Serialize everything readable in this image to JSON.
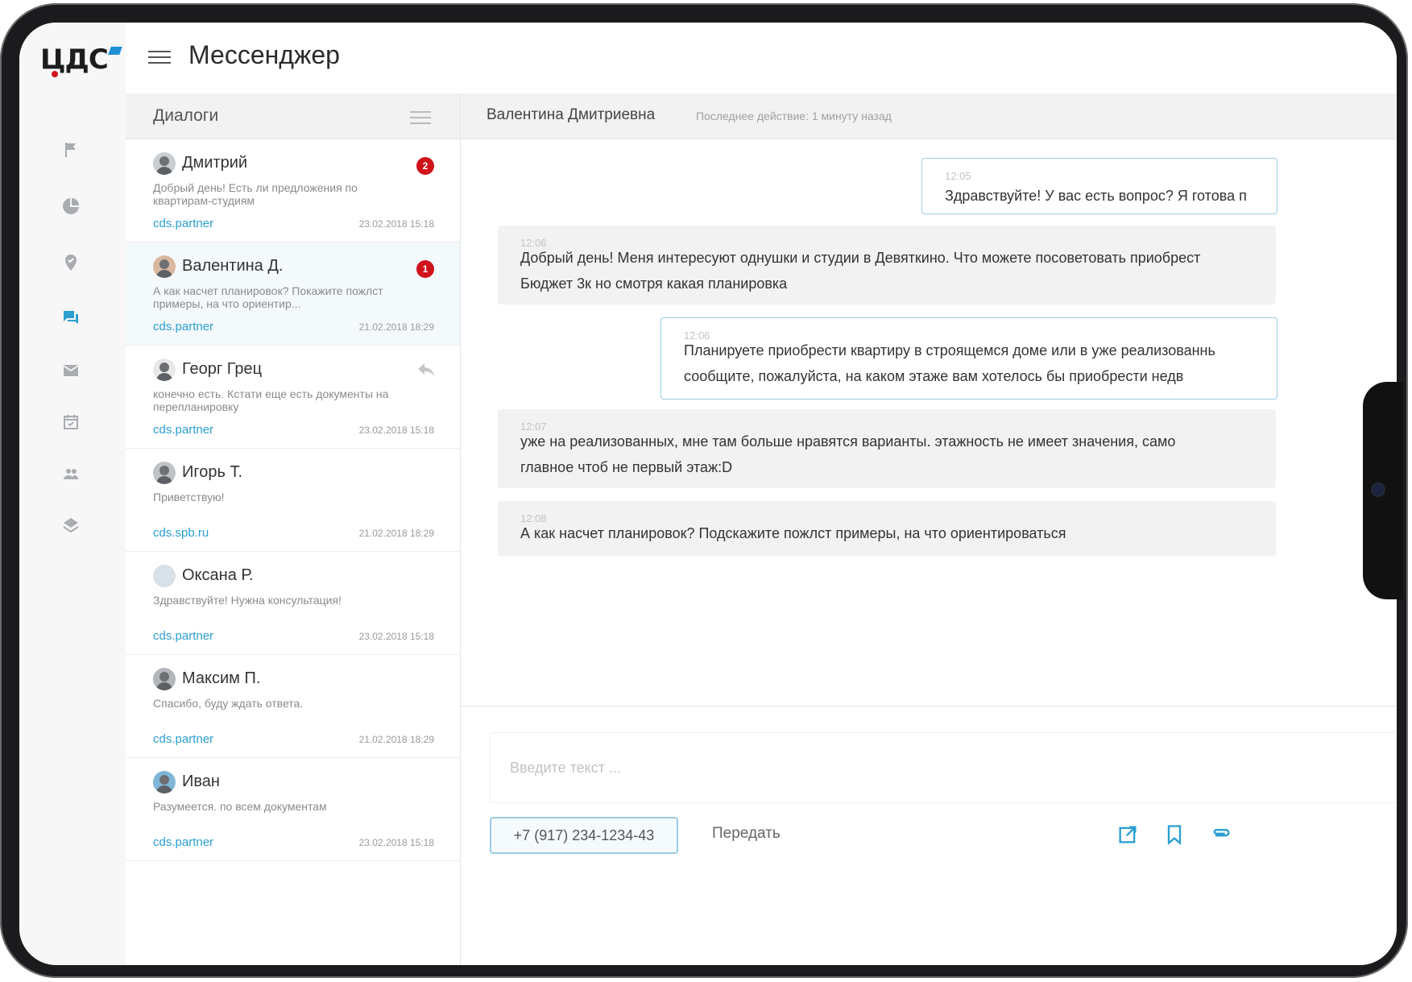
{
  "app": {
    "logo_text": "ЦДС",
    "page_title": "Мессенджер"
  },
  "rail": {
    "items": [
      {
        "icon": "flag-icon",
        "active": false
      },
      {
        "icon": "pie-chart-icon",
        "active": false
      },
      {
        "icon": "location-pin-icon",
        "active": false
      },
      {
        "icon": "chat-icon",
        "active": true
      },
      {
        "icon": "mail-icon",
        "active": false
      },
      {
        "icon": "calendar-icon",
        "active": false
      },
      {
        "icon": "people-icon",
        "active": false
      },
      {
        "icon": "layers-icon",
        "active": false
      }
    ]
  },
  "dialogs": {
    "title": "Диалоги",
    "items": [
      {
        "name": "Дмитрий",
        "snippet": "Добрый день! Есть ли предложения по квартирам-студиям",
        "source": "cds.partner",
        "date": "23.02.2018 15:18",
        "badge": "2"
      },
      {
        "name": "Валентина Д.",
        "snippet": "А как насчет планировок? Покажите пожлст примеры, на что ориентир...",
        "source": "cds.partner",
        "date": "21.02.2018 18:29",
        "badge": "1"
      },
      {
        "name": "Георг Грец",
        "snippet": "конечно есть.  Кстати еще есть документы на перепланировку",
        "source": "cds.partner",
        "date": "23.02.2018 15:18",
        "badge": ""
      },
      {
        "name": "Игорь Т.",
        "snippet": "Приветствую!",
        "source": "cds.spb.ru",
        "date": "21.02.2018 18:29",
        "badge": ""
      },
      {
        "name": "Оксана Р.",
        "snippet": "Здравствуйте! Нужна консультация!",
        "source": "cds.partner",
        "date": "23.02.2018 15:18",
        "badge": ""
      },
      {
        "name": "Максим П.",
        "snippet": "Спасибо, буду ждать ответа.",
        "source": "cds.partner",
        "date": "21.02.2018 18:29",
        "badge": ""
      },
      {
        "name": "Иван",
        "snippet": "Разумеется. по всем документам",
        "source": "cds.partner",
        "date": "23.02.2018 15:18",
        "badge": ""
      }
    ]
  },
  "chat": {
    "peer": "Валентина Дмитриевна",
    "last_action": "Последнее действие: 1 минуту назад",
    "messages": [
      {
        "time": "12:05",
        "lines": [
          "Здравствуйте! У вас есть вопрос? Я готова п"
        ]
      },
      {
        "time": "12:06",
        "lines": [
          "Добрый день! Меня интересуют однушки и студии в Девяткино. Что можете посоветовать приобрест",
          "Бюджет 3к но смотря какая планировка"
        ]
      },
      {
        "time": "12:06",
        "lines": [
          "Планируете приобрести квартиру в строящемся доме или в уже реализованнь",
          "сообщите, пожалуйста,  на каком этаже вам хотелось бы приобрести недв"
        ]
      },
      {
        "time": "12:07",
        "lines": [
          "уже на реализованных, мне там больше нравятся варианты. этажность не имеет значения, само",
          "главное чтоб не первый этаж:D"
        ]
      },
      {
        "time": "12:08",
        "lines": [
          "А как насчет планировок? Подскажите пожлст примеры, на что ориентироваться"
        ]
      }
    ],
    "input_placeholder": "Введите текст ...",
    "phone": "+7 (917) 234-1234-43",
    "send_label": "Передать"
  },
  "colors": {
    "accent": "#2a9fd0",
    "badge": "#d0121b",
    "out_bubble_border": "#9ccbe5"
  }
}
